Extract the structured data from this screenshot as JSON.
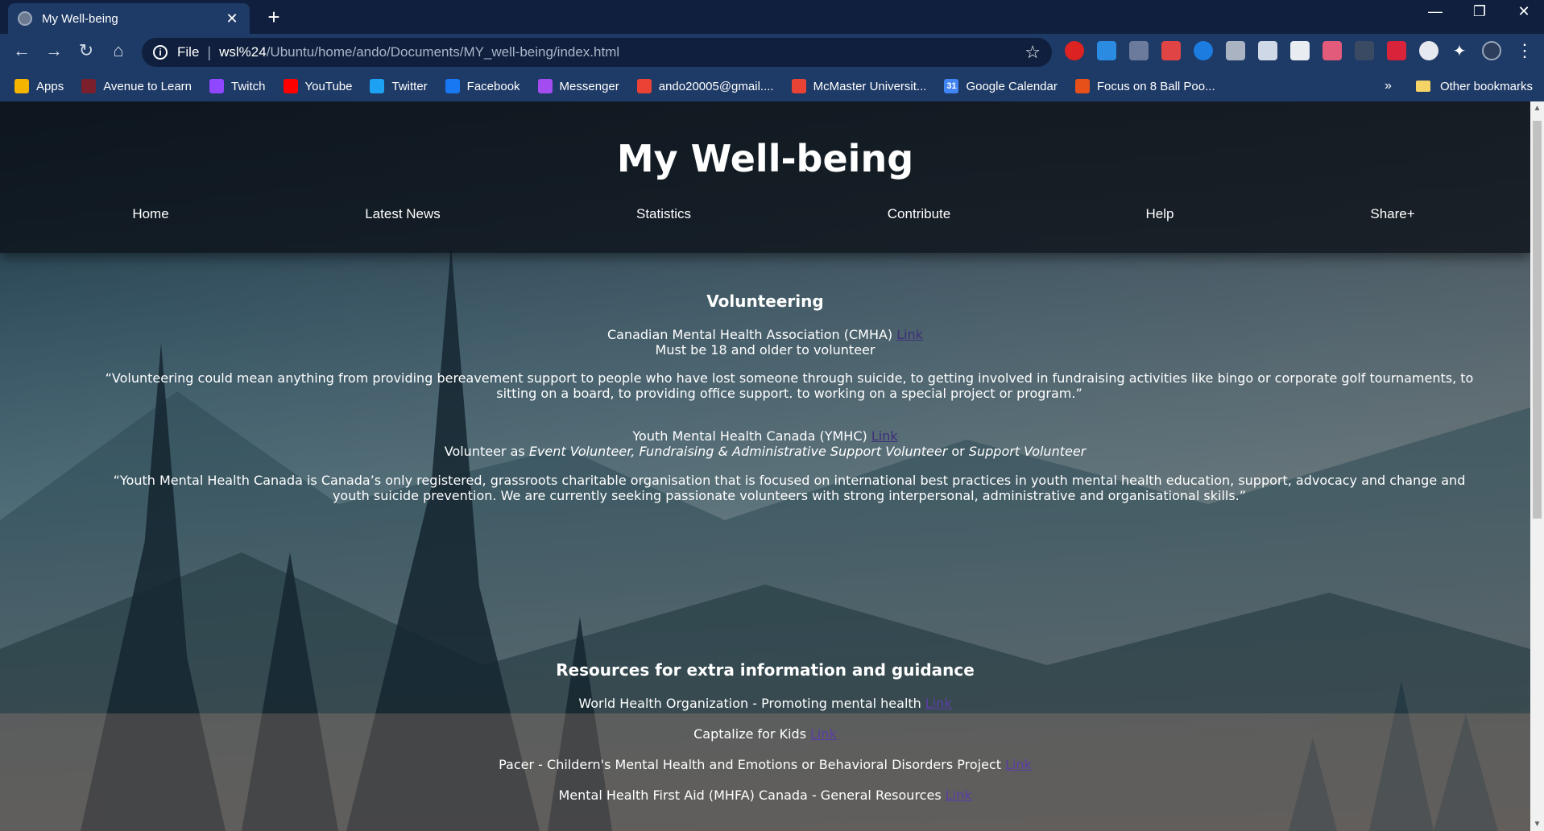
{
  "tab": {
    "title": "My Well-being"
  },
  "toolbar": {
    "scheme": "File",
    "url_host": "wsl%24",
    "url_path": "/Ubuntu/home/ando/Documents/MY_well-being/index.html"
  },
  "bookmarks": {
    "items": [
      {
        "label": "Apps",
        "icon": "apps-grid-icon",
        "color": "#f4b400"
      },
      {
        "label": "Avenue to Learn",
        "icon": "avenue-logo-icon",
        "color": "#7a1f2b"
      },
      {
        "label": "Twitch",
        "icon": "twitch-icon",
        "color": "#9146ff"
      },
      {
        "label": "YouTube",
        "icon": "youtube-icon",
        "color": "#ff0000"
      },
      {
        "label": "Twitter",
        "icon": "twitter-icon",
        "color": "#1da1f2"
      },
      {
        "label": "Facebook",
        "icon": "facebook-icon",
        "color": "#1877f2"
      },
      {
        "label": "Messenger",
        "icon": "messenger-icon",
        "color": "#a34cf0"
      },
      {
        "label": "ando20005@gmail....",
        "icon": "gmail-icon",
        "color": "#ea4335"
      },
      {
        "label": "McMaster Universit...",
        "icon": "gmail-icon",
        "color": "#ea4335"
      },
      {
        "label": "Google Calendar",
        "icon": "calendar-icon",
        "color": "#4285f4",
        "glyph": "31"
      },
      {
        "label": "Focus on 8 Ball Poo...",
        "icon": "focus-icon",
        "color": "#e8501a"
      }
    ],
    "more": "»",
    "other": "Other bookmarks"
  },
  "site": {
    "title": "My Well-being",
    "nav": [
      "Home",
      "Latest News",
      "Statistics",
      "Contribute",
      "Help",
      "Share+"
    ]
  },
  "volunteering": {
    "heading": "Volunteering",
    "cmha_name": "Canadian Mental Health Association (CMHA)",
    "cmha_link": "Link",
    "cmha_note": "Must be 18 and older to volunteer",
    "cmha_quote_1": "“Volunteering could mean anything from providing bereavement support to people who have lost someone through suicide, to getting involved in fundraising activities like bingo or corporate golf tournaments, to",
    "cmha_quote_2": "sitting on a board, to providing office support. to working on a special project or program.”",
    "ymhc_name": "Youth Mental Health Canada (YMHC)",
    "ymhc_link": "Link",
    "ymhc_note_prefix": "Volunteer as",
    "ymhc_note_roles": "Event Volunteer, Fundraising & Administrative Support Volunteer",
    "ymhc_note_or": "or",
    "ymhc_note_role2": "Support Volunteer",
    "ymhc_quote_1": "“Youth Mental Health Canada is Canada’s only registered, grassroots charitable organisation that is focused on international best practices in youth mental health education, support, advocacy and change and",
    "ymhc_quote_2": "youth suicide prevention. We are currently seeking passionate volunteers with strong interpersonal, administrative and organisational skills.”"
  },
  "resources": {
    "heading": "Resources for extra information and guidance",
    "items": [
      {
        "text": "World Health Organization - Promoting mental health",
        "link": "Link"
      },
      {
        "text": "Captalize for Kids",
        "link": "Link"
      },
      {
        "text": "Pacer - Childern's Mental Health and Emotions or Behavioral Disorders Project",
        "link": "Link"
      },
      {
        "text": "Mental Health First Aid (MHFA) Canada - General Resources",
        "link": "Link"
      }
    ]
  }
}
